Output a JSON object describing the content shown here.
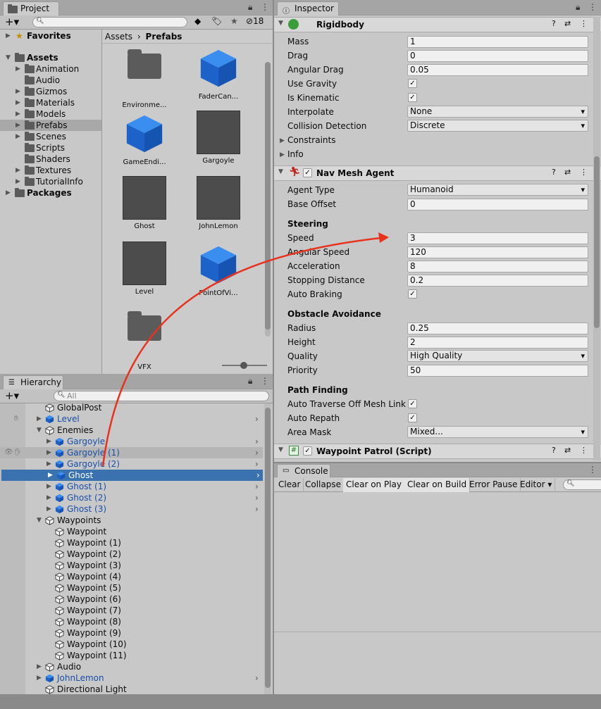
{
  "project": {
    "tab": "Project",
    "hidden_count": "18",
    "tree": [
      {
        "label": "Favorites",
        "bold": true,
        "icon": "star"
      },
      {
        "label": "Assets",
        "bold": true,
        "icon": "folder"
      },
      {
        "label": "Animation",
        "icon": "folder"
      },
      {
        "label": "Audio",
        "icon": "folder"
      },
      {
        "label": "Gizmos",
        "icon": "folder"
      },
      {
        "label": "Materials",
        "icon": "folder"
      },
      {
        "label": "Models",
        "icon": "folder"
      },
      {
        "label": "Prefabs",
        "icon": "folder",
        "selected": true
      },
      {
        "label": "Scenes",
        "icon": "folder"
      },
      {
        "label": "Scripts",
        "icon": "folder"
      },
      {
        "label": "Shaders",
        "icon": "folder"
      },
      {
        "label": "Textures",
        "icon": "folder"
      },
      {
        "label": "TutorialInfo",
        "icon": "folder"
      },
      {
        "label": "Packages",
        "bold": true,
        "icon": "folder"
      }
    ],
    "breadcrumb": [
      "Assets",
      "Prefabs"
    ],
    "assets": [
      "Environme...",
      "FaderCan...",
      "GameEndi...",
      "Gargoyle",
      "Ghost",
      "JohnLemon",
      "Level",
      "PointOfVi...",
      "VFX"
    ]
  },
  "hierarchy": {
    "tab": "Hierarchy",
    "search_placeholder": "All",
    "items": [
      "GlobalPost",
      "Level",
      "Enemies",
      "Gargoyle",
      "Gargoyle (1)",
      "Gargoyle (2)",
      "Ghost",
      "Ghost (1)",
      "Ghost (2)",
      "Ghost (3)",
      "Waypoints",
      "Waypoint",
      "Waypoint (1)",
      "Waypoint (2)",
      "Waypoint (3)",
      "Waypoint (4)",
      "Waypoint (5)",
      "Waypoint (6)",
      "Waypoint (7)",
      "Waypoint (8)",
      "Waypoint (9)",
      "Waypoint (10)",
      "Waypoint (11)",
      "Audio",
      "JohnLemon",
      "Directional Light"
    ]
  },
  "inspector": {
    "tab": "Inspector",
    "rigidbody": {
      "title": "Rigidbody",
      "labels": [
        "Mass",
        "Drag",
        "Angular Drag",
        "Use Gravity",
        "Is Kinematic",
        "Interpolate",
        "Collision Detection",
        "Constraints",
        "Info"
      ],
      "mass": "1",
      "drag": "0",
      "angular_drag": "0.05",
      "interpolate": "None",
      "collision": "Discrete"
    },
    "navmesh": {
      "title": "Nav Mesh Agent",
      "agent_type_label": "Agent Type",
      "agent_type": "Humanoid",
      "base_offset_label": "Base Offset",
      "base_offset": "0",
      "steering_header": "Steering",
      "speed_label": "Speed",
      "speed": "3",
      "angular_speed_label": "Angular Speed",
      "angular_speed": "120",
      "acceleration_label": "Acceleration",
      "acceleration": "8",
      "stopping_label": "Stopping Distance",
      "stopping": "0.2",
      "auto_braking_label": "Auto Braking",
      "obstacle_header": "Obstacle Avoidance",
      "radius_label": "Radius",
      "radius": "0.25",
      "height_label": "Height",
      "height": "2",
      "quality_label": "Quality",
      "quality": "High Quality",
      "priority_label": "Priority",
      "priority": "50",
      "path_header": "Path Finding",
      "auto_traverse_label": "Auto Traverse Off Mesh Link",
      "auto_repath_label": "Auto Repath",
      "area_mask_label": "Area Mask",
      "area_mask": "Mixed..."
    },
    "waypoint_script": {
      "title": "Waypoint Patrol (Script)"
    }
  },
  "console": {
    "tab": "Console",
    "buttons": [
      "Clear",
      "Collapse",
      "Clear on Play",
      "Clear on Build",
      "Error Pause",
      "Editor"
    ]
  },
  "colors": {
    "selection": "#3a72b0",
    "prefab_blue": "#1c62c9",
    "arrow": "#e8321e"
  }
}
